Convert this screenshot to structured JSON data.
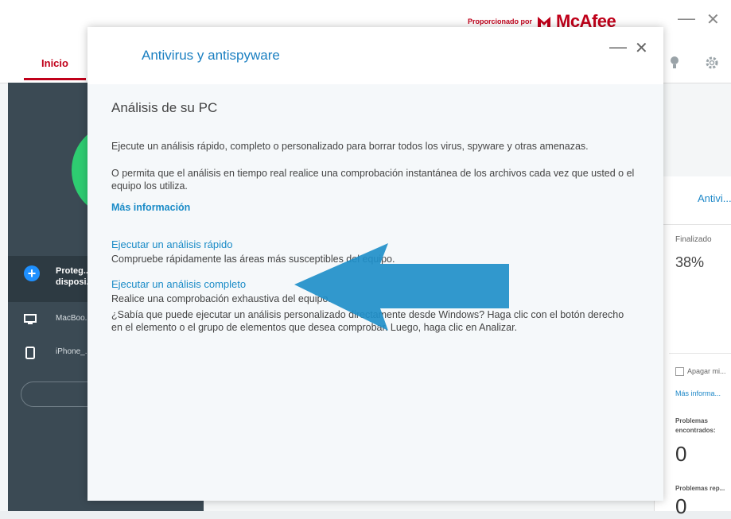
{
  "brand": {
    "powered_by": "Proporcionado por",
    "name": "McAfee"
  },
  "main_window": {
    "minimize": "—",
    "close": "✕",
    "tab_home": "Inicio"
  },
  "sidebar": {
    "protect_devices": "Proteg... disposi...",
    "devices": [
      {
        "name": "MacBoo... (2)",
        "icon": "laptop-icon"
      },
      {
        "name": "iPhone_...",
        "icon": "phone-icon"
      }
    ],
    "add_button": "◯ A..."
  },
  "right_panel": {
    "title": "Antivi...",
    "status_label": "Finalizado",
    "progress": "38%",
    "progress_value": 38,
    "shutdown_label": "Apagar mi...",
    "more_info": "Más informa...",
    "problems_found_label": "Problemas encontrados:",
    "problems_found": "0",
    "problems_repaired_label": "Problemas rep...",
    "problems_repaired": "0"
  },
  "dialog": {
    "title": "Antivirus y antispyware",
    "minimize": "—",
    "close": "✕",
    "section_title": "Análisis de su PC",
    "intro1": "Ejecute un análisis rápido, completo o personalizado para borrar todos los virus, spyware y otras amenazas.",
    "intro2": "O permita que el análisis en tiempo real realice una comprobación instantánea de los archivos cada vez que usted o el equipo los utiliza.",
    "more_info": "Más información",
    "quick_scan_link": "Ejecutar un análisis rápido",
    "quick_scan_desc": "Compruebe rápidamente las áreas más susceptibles del equipo.",
    "full_scan_link": "Ejecutar un análisis completo",
    "full_scan_desc": "Realice una comprobación exhaustiva del equipo.",
    "custom_tip": "¿Sabía que puede ejecutar un análisis personalizado directamente desde Windows? Haga clic con el botón derecho en el elemento o el grupo de elementos que desea comprobar. Luego, haga clic en Analizar."
  },
  "colors": {
    "brand_red": "#c0001a",
    "link_blue": "#1a8bc7",
    "sidebar": "#3b4a54",
    "status_green": "#2ecc71",
    "arrow_blue": "#1f8fc9"
  }
}
